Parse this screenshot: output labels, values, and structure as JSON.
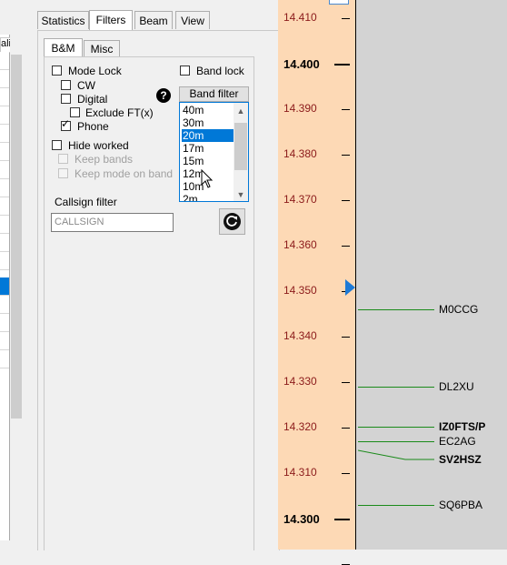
{
  "top_tabs": [
    {
      "label": "Statistics",
      "active": false
    },
    {
      "label": "Filters",
      "active": true
    },
    {
      "label": "Beam",
      "active": false
    },
    {
      "label": "View",
      "active": false
    }
  ],
  "left_strip": {
    "header": "ali"
  },
  "sub_tabs": [
    {
      "label": "B&M",
      "active": true
    },
    {
      "label": "Misc",
      "active": false
    }
  ],
  "filters": {
    "mode_lock": {
      "label": "Mode Lock",
      "checked": false
    },
    "cw": {
      "label": "CW",
      "checked": false
    },
    "digital": {
      "label": "Digital",
      "checked": false
    },
    "exclude_ft": {
      "label": "Exclude FT(x)",
      "checked": false
    },
    "phone": {
      "label": "Phone",
      "checked": true
    },
    "hide_worked": {
      "label": "Hide worked",
      "checked": false
    },
    "keep_bands": {
      "label": "Keep bands",
      "checked": false
    },
    "keep_mode": {
      "label": "Keep mode on band",
      "checked": false
    },
    "band_lock": {
      "label": "Band lock",
      "checked": false
    },
    "band_filter_label": "Band filter",
    "bands": [
      "40m",
      "30m",
      "20m",
      "17m",
      "15m",
      "12m",
      "10m",
      "2m"
    ],
    "selected_band": "20m",
    "callsign_filter_label": "Callsign filter",
    "callsign_placeholder": "CALLSIGN",
    "help_glyph": "?"
  },
  "band_map": {
    "freq_labels": [
      {
        "text": "14.410",
        "major": false
      },
      {
        "text": "14.400",
        "major": true
      },
      {
        "text": "14.390",
        "major": false
      },
      {
        "text": "14.380",
        "major": false
      },
      {
        "text": "14.370",
        "major": false
      },
      {
        "text": "14.360",
        "major": false
      },
      {
        "text": "14.350",
        "major": false
      },
      {
        "text": "14.340",
        "major": false
      },
      {
        "text": "14.330",
        "major": false
      },
      {
        "text": "14.320",
        "major": false
      },
      {
        "text": "14.310",
        "major": false
      },
      {
        "text": "14.300",
        "major": true
      }
    ],
    "spots": [
      {
        "call": "M0CCG",
        "bold": false
      },
      {
        "call": "DL2XU",
        "bold": false
      },
      {
        "call": "IZ0FTS/P",
        "bold": true
      },
      {
        "call": "EC2AG",
        "bold": false
      },
      {
        "call": "SV2HSZ",
        "bold": true
      },
      {
        "call": "SQ6PBA",
        "bold": false
      }
    ],
    "colors": {
      "axis_bg": "#fdd9b5",
      "map_bg": "#d3d3d3",
      "spot_line": "#1a8a1a",
      "minor_label": "#8b1a1a",
      "marker": "#1e7ad6"
    }
  }
}
